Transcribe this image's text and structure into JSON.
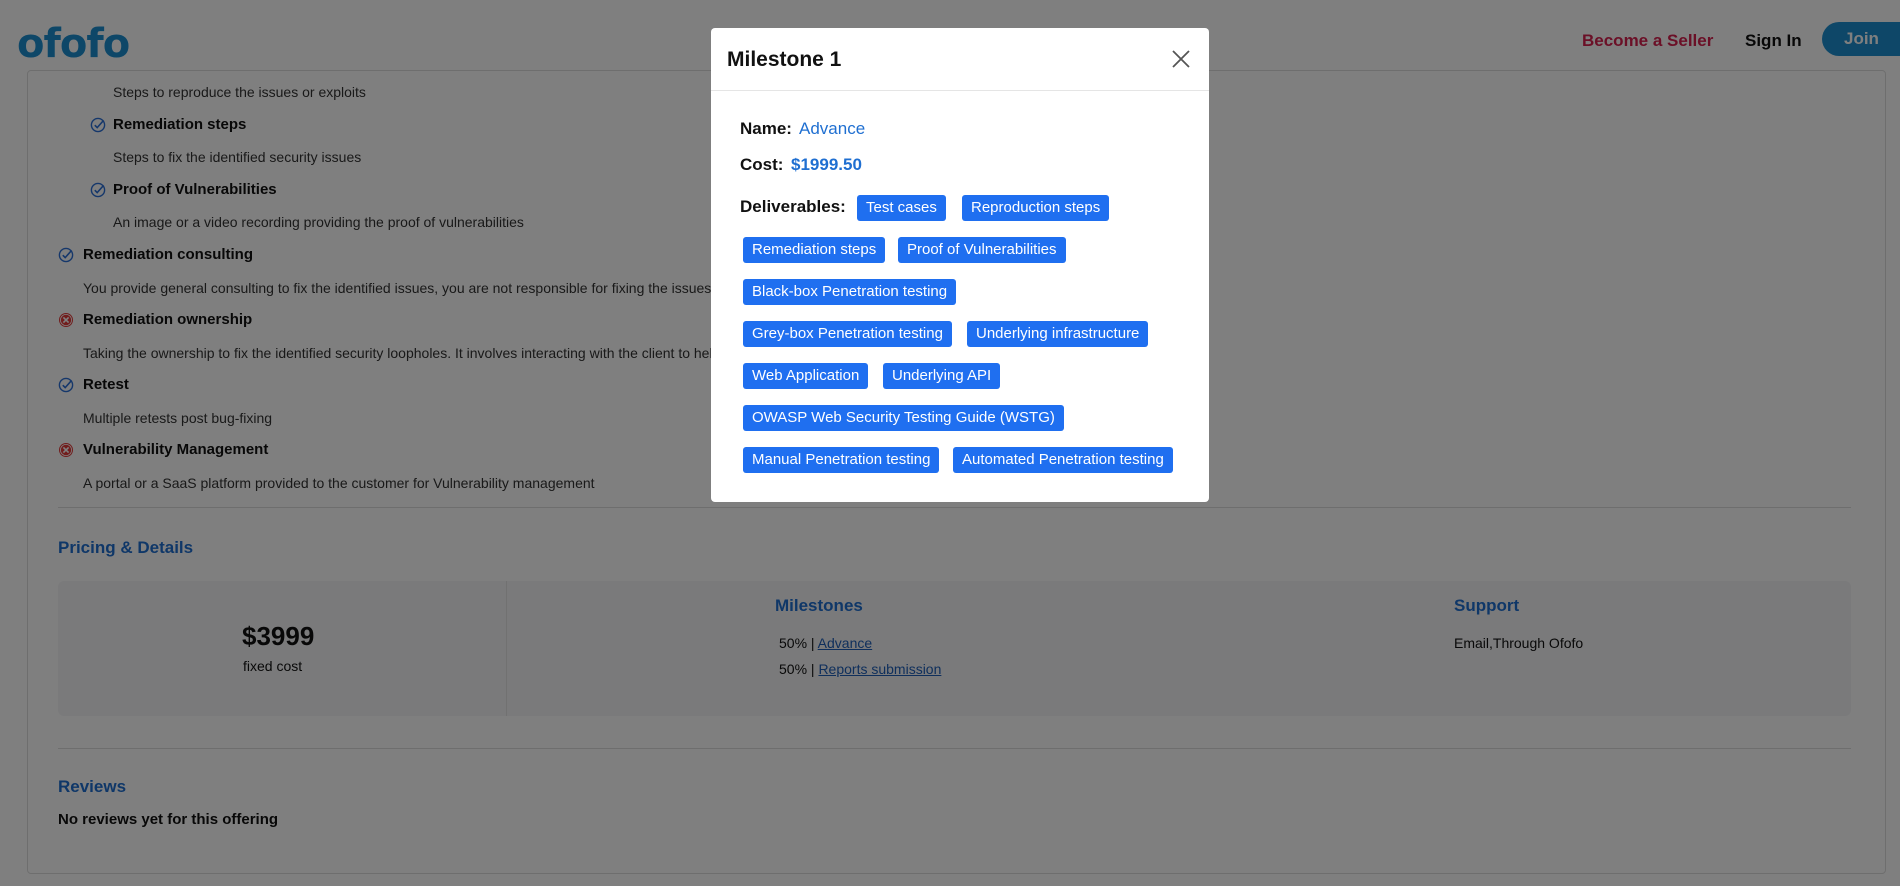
{
  "header": {
    "logo": "ofofo",
    "become_seller": "Become a Seller",
    "sign_in": "Sign In",
    "join": "Join"
  },
  "features": {
    "reproduce_desc": "Steps to reproduce the issues or exploits",
    "remediation_steps_title": "Remediation steps",
    "remediation_steps_desc": "Steps to fix the identified security issues",
    "proof_title": "Proof of Vulnerabilities",
    "proof_desc": "An image or a video recording providing the proof of vulnerabilities",
    "consulting_title": "Remediation consulting",
    "consulting_desc": "You provide general consulting to fix the identified issues, you are not responsible for fixing the issues",
    "ownership_title": "Remediation ownership",
    "ownership_desc": "Taking the ownership to fix the identified security loopholes. It involves interacting with the client to hel",
    "retest_title": "Retest",
    "retest_desc": "Multiple retests post bug-fixing",
    "vm_title": "Vulnerability Management",
    "vm_desc": "A portal or a SaaS platform provided to the customer for Vulnerability management"
  },
  "pricing": {
    "section_title": "Pricing & Details",
    "price": "$3999",
    "price_label": "fixed cost",
    "milestones_title": "Milestones",
    "milestones": [
      {
        "pct": "50% | ",
        "name": "Advance"
      },
      {
        "pct": "50% | ",
        "name": "Reports submission"
      }
    ],
    "support_title": "Support",
    "support_value": "Email,Through Ofofo"
  },
  "reviews": {
    "title": "Reviews",
    "empty": "No reviews yet for this offering"
  },
  "modal": {
    "title": "Milestone 1",
    "name_label": "Name:",
    "name_value": "Advance",
    "cost_label": "Cost:",
    "cost_value": "$1999.50",
    "deliverables_label": "Deliverables:",
    "deliverables": [
      "Test cases",
      "Reproduction steps",
      "Remediation steps",
      "Proof of Vulnerabilities",
      "Black-box Penetration testing",
      "Grey-box Penetration testing",
      "Underlying infrastructure",
      "Web Application",
      "Underlying API",
      "OWASP Web Security Testing Guide (WSTG)",
      "Manual Penetration testing",
      "Automated Penetration testing"
    ]
  },
  "colors": {
    "brand": "#1d8fd0",
    "accent_red": "#d6204f",
    "link_blue": "#1f6fd1",
    "chip_blue": "#1f6ff0"
  }
}
